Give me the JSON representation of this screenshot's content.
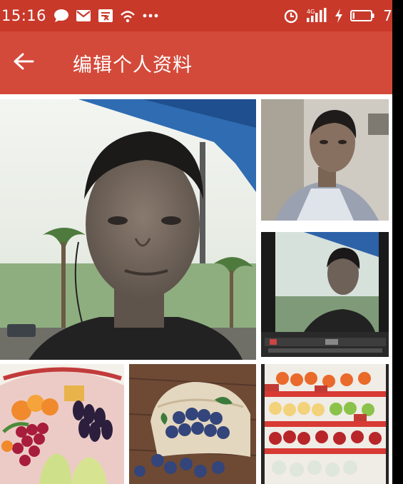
{
  "status_bar": {
    "time": "15:16",
    "left_icons": [
      "chat-bubble-icon",
      "mail-icon",
      "reader-icon",
      "wifi-icon",
      "more-dots-icon"
    ],
    "network_label": "4G",
    "battery_level": "7",
    "bg_color": "#c8392a"
  },
  "toolbar": {
    "title": "编辑个人资料",
    "back_icon": "back-arrow-icon",
    "bg_color": "#d44a3a"
  },
  "photos": [
    {
      "name": "main-photo",
      "depicts": "portrait-with-palm-trees"
    },
    {
      "name": "photo-2",
      "depicts": "portrait-indoor"
    },
    {
      "name": "photo-3",
      "depicts": "portrait-on-screen"
    },
    {
      "name": "photo-4",
      "depicts": "fruit-basket"
    },
    {
      "name": "photo-5",
      "depicts": "blueberries-sack"
    },
    {
      "name": "photo-6",
      "depicts": "fruit-shelf"
    }
  ]
}
